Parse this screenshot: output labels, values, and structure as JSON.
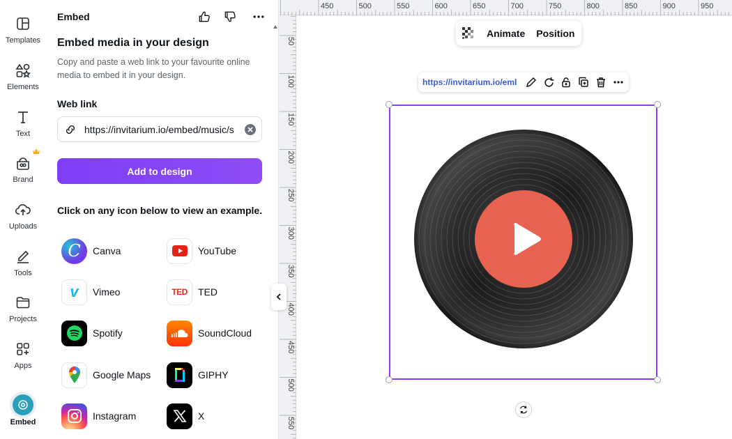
{
  "rail": {
    "items": [
      {
        "label": "Templates",
        "icon": "templates-icon"
      },
      {
        "label": "Elements",
        "icon": "elements-icon"
      },
      {
        "label": "Text",
        "icon": "text-icon"
      },
      {
        "label": "Brand",
        "icon": "brand-icon"
      },
      {
        "label": "Uploads",
        "icon": "uploads-icon"
      },
      {
        "label": "Tools",
        "icon": "tools-icon"
      },
      {
        "label": "Projects",
        "icon": "projects-icon"
      },
      {
        "label": "Apps",
        "icon": "apps-icon"
      },
      {
        "label": "Embed",
        "icon": "embed-icon"
      }
    ]
  },
  "panel": {
    "header": "Embed",
    "title": "Embed media in your design",
    "description": "Copy and paste a web link to your favourite online media to embed it in your design.",
    "web_link_label": "Web link",
    "web_link_value": "https://invitarium.io/embed/music/s",
    "add_button": "Add to design",
    "examples_heading": "Click on any icon below to view an example.",
    "services": [
      {
        "label": "Canva"
      },
      {
        "label": "YouTube"
      },
      {
        "label": "Vimeo"
      },
      {
        "label": "TED"
      },
      {
        "label": "Spotify"
      },
      {
        "label": "SoundCloud"
      },
      {
        "label": "Google Maps"
      },
      {
        "label": "GIPHY"
      },
      {
        "label": "Instagram"
      },
      {
        "label": "X"
      }
    ]
  },
  "ruler": {
    "top": [
      "450",
      "500",
      "550",
      "600",
      "650",
      "700",
      "750",
      "800",
      "850",
      "900",
      "950"
    ],
    "left": [
      "50",
      "100",
      "150",
      "200",
      "250",
      "300",
      "350",
      "400",
      "450",
      "500",
      "550"
    ]
  },
  "toolbar": {
    "animate": "Animate",
    "position": "Position"
  },
  "context": {
    "url": "https://invitarium.io/embed/music"
  },
  "colors": {
    "accent": "#8b3dff",
    "play": "#e8634f",
    "vinyl": "#1a1a1a"
  }
}
